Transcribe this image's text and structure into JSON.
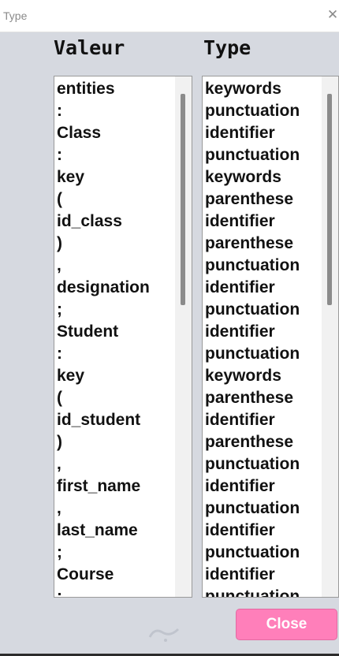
{
  "window": {
    "title": "Type",
    "close_glyph": "✕"
  },
  "columns": {
    "valeur_header": "Valeur",
    "type_header": "Type"
  },
  "valeur_items": [
    "entities",
    ":",
    "Class",
    ":",
    "key",
    "(",
    "id_class",
    ")",
    ",",
    "designation",
    ";",
    "Student",
    ":",
    "key",
    "(",
    "id_student",
    ")",
    ",",
    "first_name",
    ",",
    "last_name",
    ";",
    "Course",
    ":"
  ],
  "type_items": [
    "keywords",
    "punctuation",
    "identifier",
    "punctuation",
    "keywords",
    "parenthese",
    "identifier",
    "parenthese",
    "punctuation",
    "identifier",
    "punctuation",
    "identifier",
    "punctuation",
    "keywords",
    "parenthese",
    "identifier",
    "parenthese",
    "punctuation",
    "identifier",
    "punctuation",
    "identifier",
    "punctuation",
    "identifier",
    "punctuation"
  ],
  "buttons": {
    "close_label": "Close"
  },
  "colors": {
    "close_button": "#ff7fba",
    "background": "#d6d9e0"
  }
}
